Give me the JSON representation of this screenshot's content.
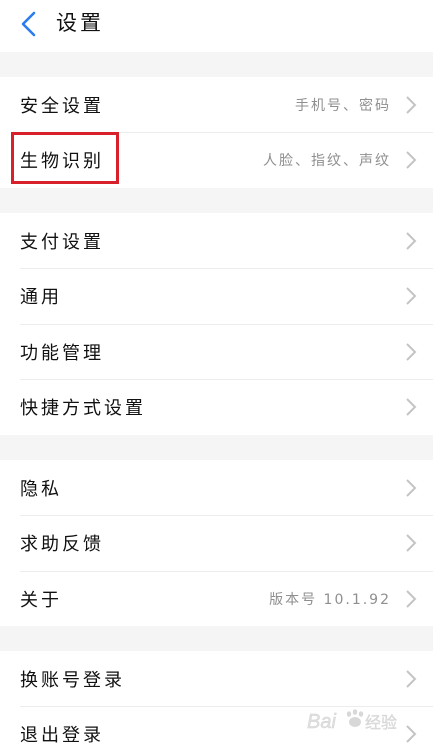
{
  "header": {
    "title": "设置"
  },
  "groups": [
    {
      "items": [
        {
          "label": "安全设置",
          "value": "手机号、密码"
        },
        {
          "label": "生物识别",
          "value": "人脸、指纹、声纹"
        }
      ]
    },
    {
      "items": [
        {
          "label": "支付设置"
        },
        {
          "label": "通用"
        },
        {
          "label": "功能管理"
        },
        {
          "label": "快捷方式设置"
        }
      ]
    },
    {
      "items": [
        {
          "label": "隐私"
        },
        {
          "label": "求助反馈"
        },
        {
          "label": "关于",
          "value": "版本号 10.1.92"
        }
      ]
    },
    {
      "items": [
        {
          "label": "换账号登录"
        },
        {
          "label": "退出登录"
        }
      ]
    }
  ],
  "annotation": {
    "highlighted_item": "生物识别",
    "highlight_color": "#d8202a"
  },
  "watermark": {
    "text": "Baidu经验"
  },
  "colors": {
    "accent": "#2b7cf0",
    "background": "#f5f5f6"
  }
}
